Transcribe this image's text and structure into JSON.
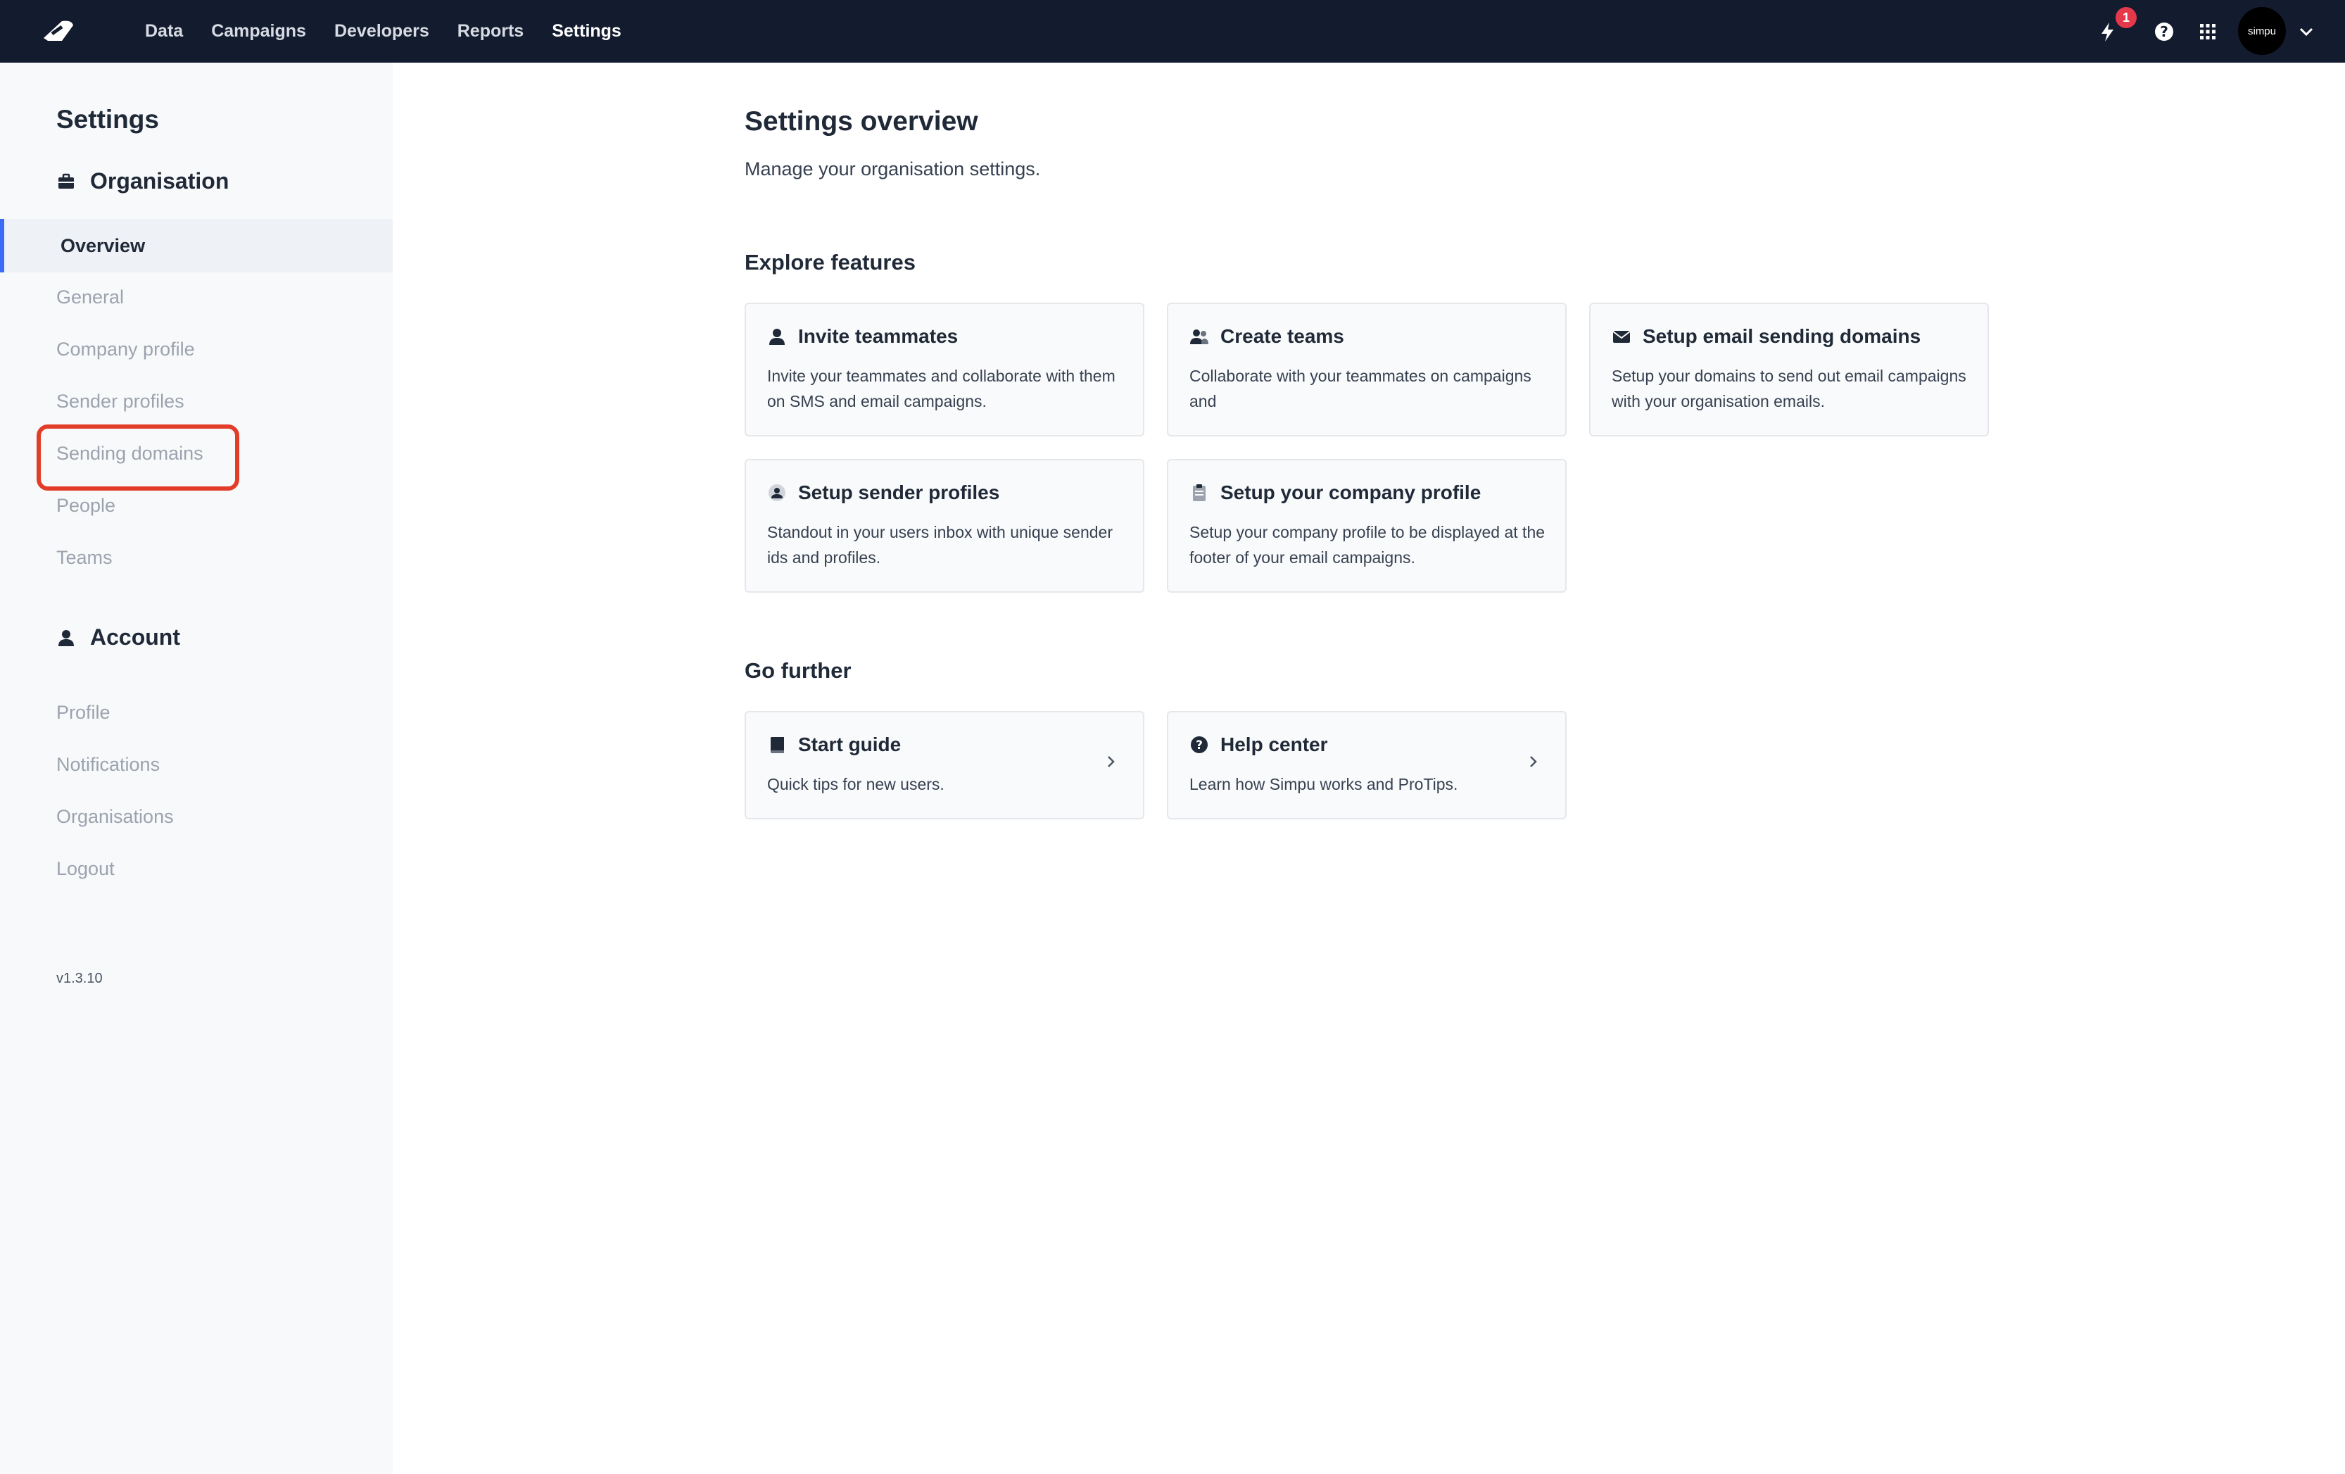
{
  "nav": {
    "items": [
      "Data",
      "Campaigns",
      "Developers",
      "Reports",
      "Settings"
    ],
    "active": "Settings",
    "notification_count": "1",
    "avatar_text": "simpu"
  },
  "sidebar": {
    "title": "Settings",
    "organisation": {
      "label": "Organisation",
      "icon": "briefcase-icon",
      "items": [
        "Overview",
        "General",
        "Company profile",
        "Sender profiles",
        "Sending domains",
        "People",
        "Teams"
      ]
    },
    "account": {
      "label": "Account",
      "icon": "person-icon",
      "items": [
        "Profile",
        "Notifications",
        "Organisations",
        "Logout"
      ]
    },
    "version": "v1.3.10"
  },
  "main": {
    "title": "Settings overview",
    "subtitle": "Manage your organisation settings.",
    "explore_title": "Explore features",
    "features": [
      {
        "title": "Invite teammates",
        "desc": "Invite your teammates and collaborate with them on SMS and email campaigns.",
        "icon": "person-icon"
      },
      {
        "title": "Create teams",
        "desc": "Collaborate with your teammates on campaigns and",
        "icon": "group-icon"
      },
      {
        "title": "Setup email sending domains",
        "desc": "Setup your domains to send out email campaigns with your organisation emails.",
        "icon": "envelope-icon"
      },
      {
        "title": "Setup sender profiles",
        "desc": "Standout in your users inbox with unique sender ids and profiles.",
        "icon": "profile-circle-icon"
      },
      {
        "title": "Setup your company profile",
        "desc": "Setup your company profile to be displayed at the footer of your email campaigns.",
        "icon": "clipboard-icon"
      }
    ],
    "further_title": "Go further",
    "further": [
      {
        "title": "Start guide",
        "desc": "Quick tips for new users.",
        "icon": "book-icon"
      },
      {
        "title": "Help center",
        "desc": "Learn how Simpu works and ProTips.",
        "icon": "question-circle-icon"
      }
    ]
  },
  "colors": {
    "topbar": "#131b2e",
    "accent": "#3b6cf5",
    "highlight": "#e23d28",
    "badge": "#e5394b"
  }
}
